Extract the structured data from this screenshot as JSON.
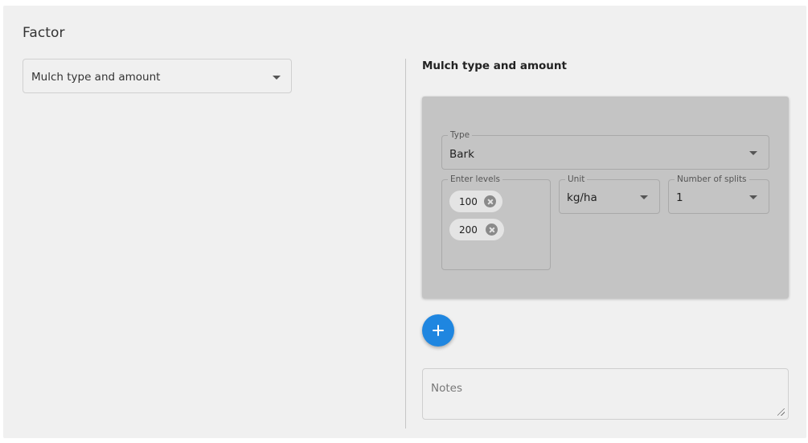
{
  "factor": {
    "title": "Factor",
    "selected": "Mulch type and amount"
  },
  "detail": {
    "heading": "Mulch type and amount",
    "type_field": {
      "label": "Type",
      "value": "Bark"
    },
    "levels_field": {
      "label": "Enter levels",
      "chips": [
        "100",
        "200"
      ]
    },
    "unit_field": {
      "label": "Unit",
      "value": "kg/ha"
    },
    "splits_field": {
      "label": "Number of splits",
      "value": "1"
    },
    "notes_placeholder": "Notes"
  },
  "colors": {
    "panel_background": "#f0f0f0",
    "card_background": "#c4c4c4",
    "fab_accent": "#1f86e0"
  },
  "icons": {
    "select_caret": "chevron-down-icon",
    "chip_delete": "close-circle-icon",
    "add_button": "plus-icon",
    "textarea_resize": "resize-grip-icon"
  }
}
